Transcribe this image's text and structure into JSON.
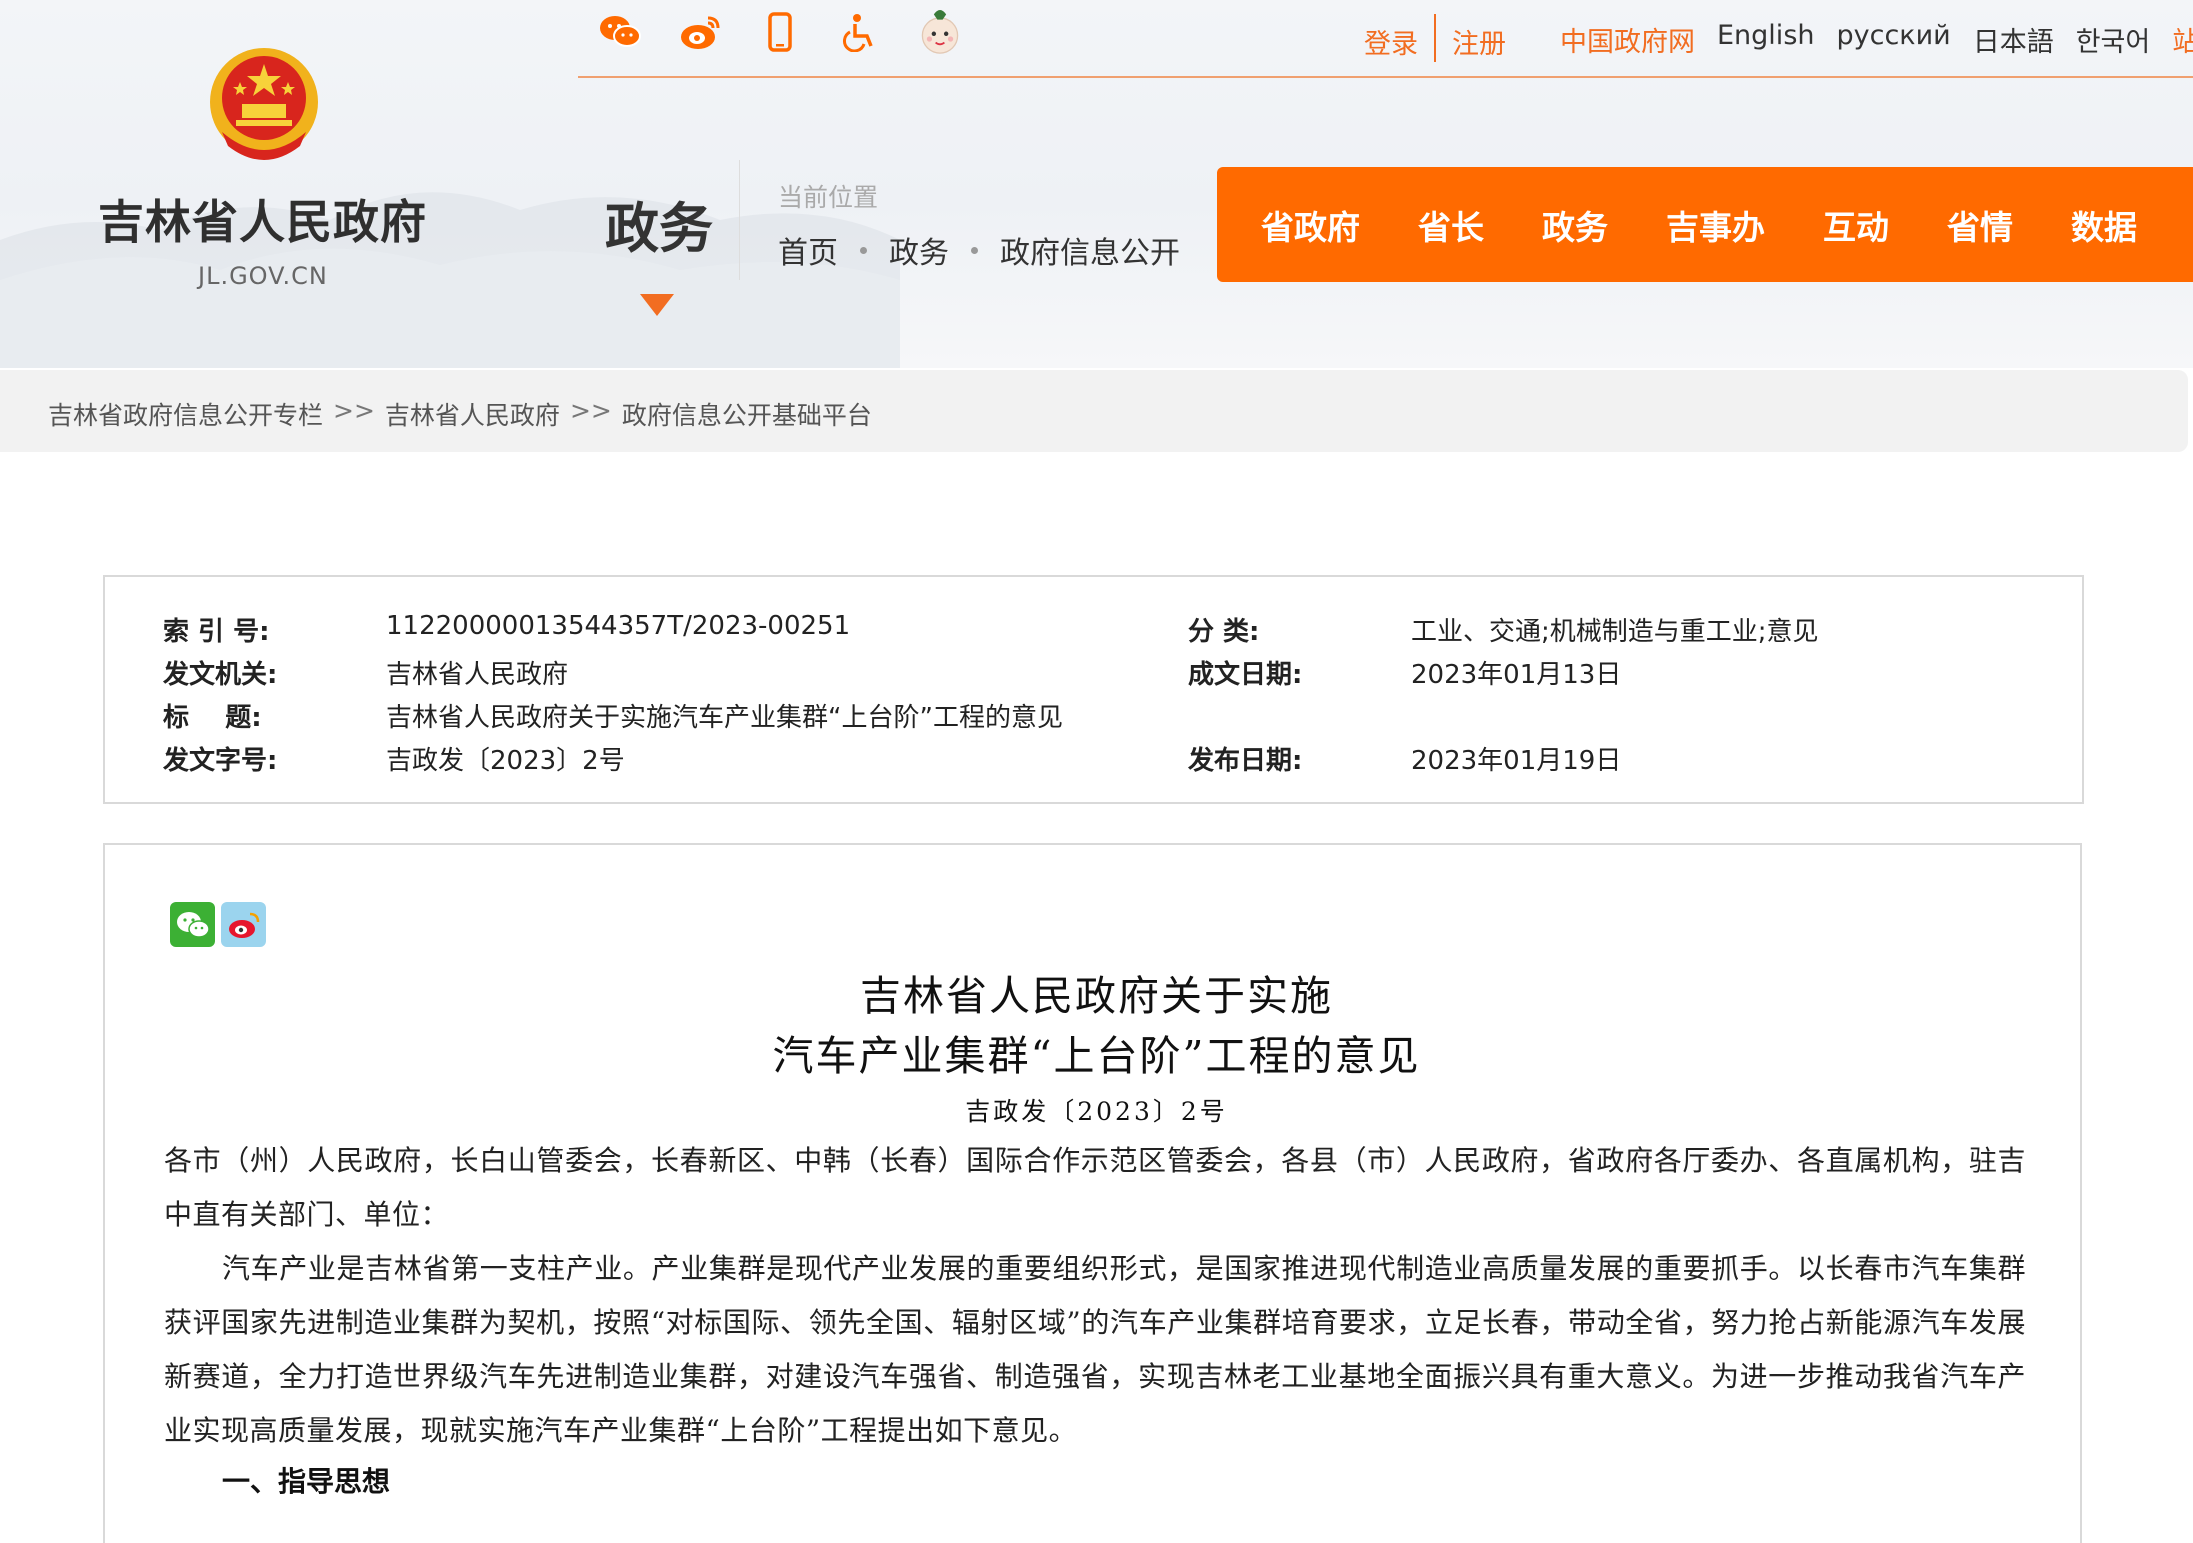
{
  "header": {
    "site_name": "吉林省人民政府",
    "site_domain": "JL.GOV.CN",
    "section_title": "政务",
    "location_label": "当前位置",
    "location_path": [
      "首页",
      "政务",
      "政府信息公开"
    ],
    "login": "登录",
    "register": "注册",
    "languages": [
      "中国政府网",
      "English",
      "русский",
      "日本語",
      "한국어",
      "站群导航"
    ],
    "top_icons": [
      "wechat-icon",
      "weibo-icon",
      "mobile-icon",
      "accessibility-icon",
      "mascot-icon"
    ],
    "main_nav": [
      "省政府",
      "省长",
      "政务",
      "吉事办",
      "互动",
      "省情",
      "数据"
    ],
    "accent_color": "#ff6a00"
  },
  "breadcrumb": [
    "吉林省政府信息公开专栏",
    "吉林省人民政府",
    "政府信息公开基础平台"
  ],
  "breadcrumb_sep": ">>",
  "meta": {
    "index_label": "索 引 号:",
    "index_value": "11220000013544357T/2023-00251",
    "category_label": "分 类:",
    "category_value": "工业、交通;机械制造与重工业;意见",
    "issuer_label": "发文机关:",
    "issuer_value": "吉林省人民政府",
    "written_date_label": "成文日期:",
    "written_date_value": "2023年01月13日",
    "title_label": "标    题:",
    "title_value": "吉林省人民政府关于实施汽车产业集群“上台阶”工程的意见",
    "doc_no_label": "发文字号:",
    "doc_no_value": "吉政发〔2023〕2号",
    "publish_date_label": "发布日期:",
    "publish_date_value": "2023年01月19日"
  },
  "document": {
    "title_line1": "吉林省人民政府关于实施",
    "title_line2": "汽车产业集群“上台阶”工程的意见",
    "number": "吉政发〔2023〕2号",
    "recipients": "各市（州）人民政府，长白山管委会，长春新区、中韩（长春）国际合作示范区管委会，各县（市）人民政府，省政府各厅委办、各直属机构，驻吉中直有关部门、单位：",
    "intro": "汽车产业是吉林省第一支柱产业。产业集群是现代产业发展的重要组织形式，是国家推进现代制造业高质量发展的重要抓手。以长春市汽车集群获评国家先进制造业集群为契机，按照“对标国际、领先全国、辐射区域”的汽车产业集群培育要求，立足长春，带动全省，努力抢占新能源汽车发展新赛道，全力打造世界级汽车先进制造业集群，对建设汽车强省、制造强省，实现吉林老工业基地全面振兴具有重大意义。为进一步推动我省汽车产业实现高质量发展，现就实施汽车产业集群“上台阶”工程提出如下意见。",
    "section1": "一、指导思想"
  }
}
